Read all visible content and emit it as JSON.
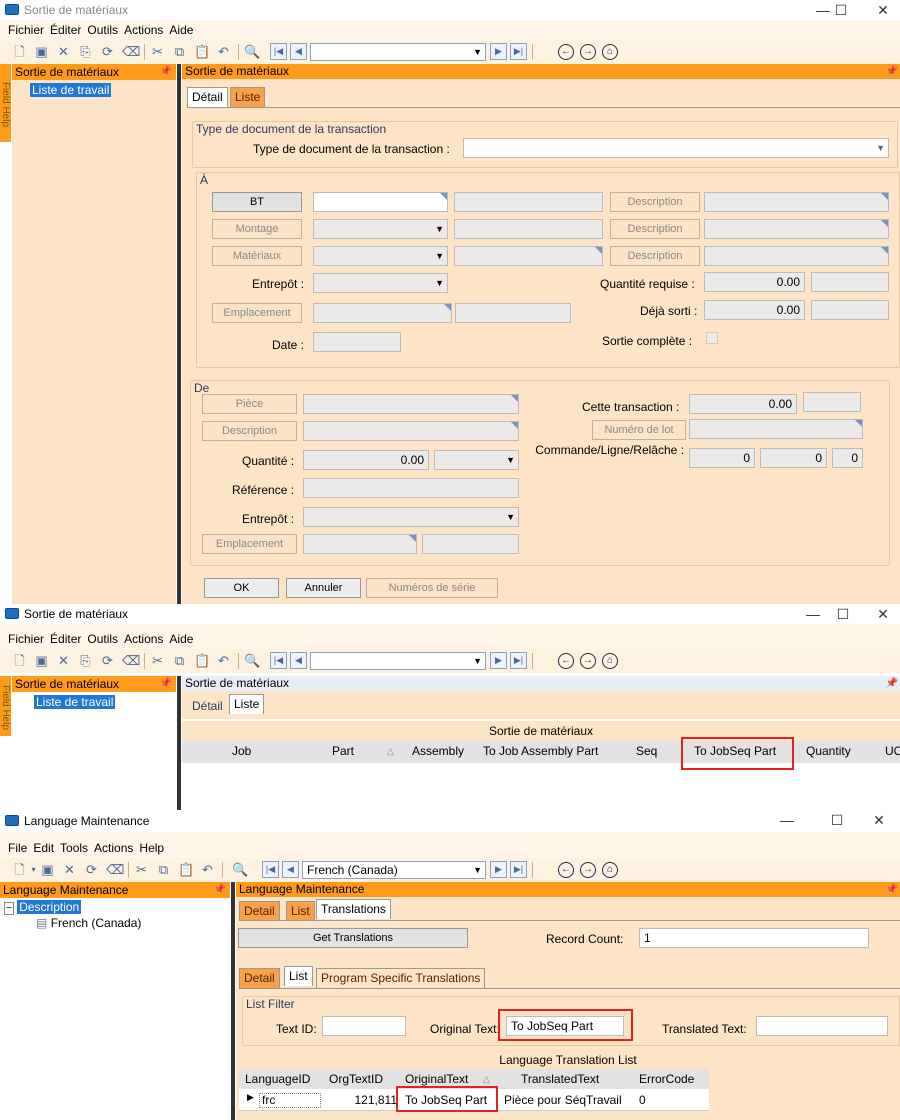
{
  "win1": {
    "title": "Sortie de matériaux",
    "menu": [
      "Fichier",
      "Éditer",
      "Outils",
      "Actions",
      "Aide"
    ],
    "sidebar_title": "Sortie de matériaux",
    "field_help": "Field Help",
    "tree_item": "Liste de travail",
    "panel_title": "Sortie de matériaux",
    "tabs": [
      "Détail",
      "Liste"
    ],
    "group_transaction": "Type de document de la transaction",
    "label_doc_type": "Type de document de la transaction :",
    "group_a": "À",
    "btn_bt": "BT",
    "btn_montage": "Montage",
    "btn_materiaux": "Matériaux",
    "btn_description": "Description",
    "label_entrepot": "Entrepôt :",
    "btn_emplacement": "Emplacement",
    "label_date": "Date :",
    "label_qte_requise": "Quantité requise :",
    "qte_requise": "0.00",
    "label_deja_sorti": "Déjà sorti :",
    "deja_sorti": "0.00",
    "label_sortie_complete": "Sortie complète :",
    "group_de": "De",
    "btn_piece": "Pièce",
    "label_quantite": "Quantité :",
    "quantite": "0.00",
    "label_reference": "Référence :",
    "label_cette_transaction": "Cette transaction :",
    "cette_transaction": "0.00",
    "btn_numero_lot": "Numéro de lot",
    "label_commande": "Commande/Ligne/Relâche :",
    "cmd_values": [
      "0",
      "0",
      "0"
    ],
    "btn_ok": "OK",
    "btn_annuler": "Annuler",
    "btn_numeros_serie": "Numéros de série"
  },
  "win2": {
    "title": "Sortie de matériaux",
    "menu": [
      "Fichier",
      "Éditer",
      "Outils",
      "Actions",
      "Aide"
    ],
    "sidebar_title": "Sortie de matériaux",
    "field_help": "Field Help",
    "tree_item": "Liste de travail",
    "panel_title": "Sortie de matériaux",
    "tabs": [
      "Détail",
      "Liste"
    ],
    "grid_title": "Sortie de matériaux",
    "columns": [
      "Job",
      "Part",
      "Assembly",
      "To Job Assembly Part",
      "Seq",
      "To JobSeq Part",
      "Quantity",
      "UO"
    ]
  },
  "win3": {
    "title": "Language Maintenance",
    "menu": [
      "File",
      "Edit",
      "Tools",
      "Actions",
      "Help"
    ],
    "nav_value": "French (Canada)",
    "sidebar_title": "Language Maintenance",
    "tree_root": "Description",
    "tree_child": "French (Canada)",
    "panel_title": "Language Maintenance",
    "tabs": [
      "Detail",
      "List",
      "Translations"
    ],
    "btn_get_translations": "Get Translations",
    "label_record_count": "Record Count:",
    "record_count": "1",
    "subtabs": [
      "Detail",
      "List",
      "Program Specific Translations"
    ],
    "filter_title": "List Filter",
    "label_text_id": "Text ID:",
    "label_original_text": "Original Text:",
    "original_text_value": "To JobSeq Part",
    "label_translated_text": "Translated Text:",
    "grid_title": "Language Translation List",
    "columns": [
      "LanguageID",
      "OrgTextID",
      "OriginalText",
      "TranslatedText",
      "ErrorCode"
    ],
    "row": [
      "frc",
      "121,811",
      "To JobSeq Part",
      "Pièce pour SéqTravail",
      "0"
    ]
  }
}
